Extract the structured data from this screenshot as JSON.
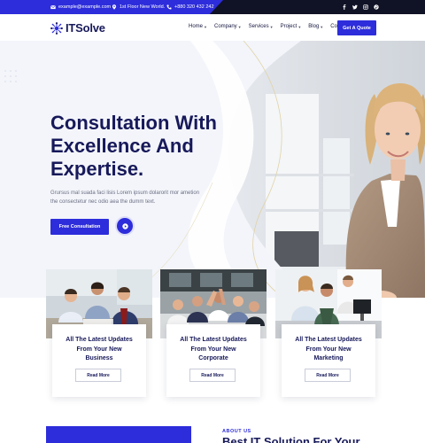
{
  "topbar": {
    "email": "example@example.com",
    "address": "1st Floor New World.",
    "phone": "+880 320 432 242",
    "social_icons": [
      "facebook-icon",
      "twitter-icon",
      "instagram-icon",
      "pinterest-icon"
    ]
  },
  "header": {
    "logo_text": "ITSolve",
    "nav": [
      {
        "label": "Home",
        "has_dropdown": true
      },
      {
        "label": "Company",
        "has_dropdown": true
      },
      {
        "label": "Services",
        "has_dropdown": true
      },
      {
        "label": "Project",
        "has_dropdown": true
      },
      {
        "label": "Blog",
        "has_dropdown": true
      },
      {
        "label": "Contact",
        "has_dropdown": false
      }
    ],
    "cta_label": "Get A Quote"
  },
  "hero": {
    "title_lines": [
      "Consultation With",
      "Excellence And",
      "Expertise."
    ],
    "description_lines": [
      "Grursus mal suada faci lisis Lorem ipsum dolarorit mor ametion",
      "the consectetur nec odio aea the dumm text."
    ],
    "primary_button": "Free Consultation"
  },
  "cards": [
    {
      "title_lines": [
        "All The Latest Updates",
        "From Your New",
        "Business"
      ],
      "button": "Read More"
    },
    {
      "title_lines": [
        "All The Latest Updates",
        "From Your New",
        "Corporate"
      ],
      "button": "Read More"
    },
    {
      "title_lines": [
        "All The Latest Updates",
        "From Your New",
        "Marketing"
      ],
      "button": "Read More"
    }
  ],
  "about": {
    "label": "ABOUT US",
    "title": "Best IT Solution For Your"
  },
  "colors": {
    "primary": "#2d2ddb",
    "navy": "#17195a",
    "topbar": "#101226"
  }
}
